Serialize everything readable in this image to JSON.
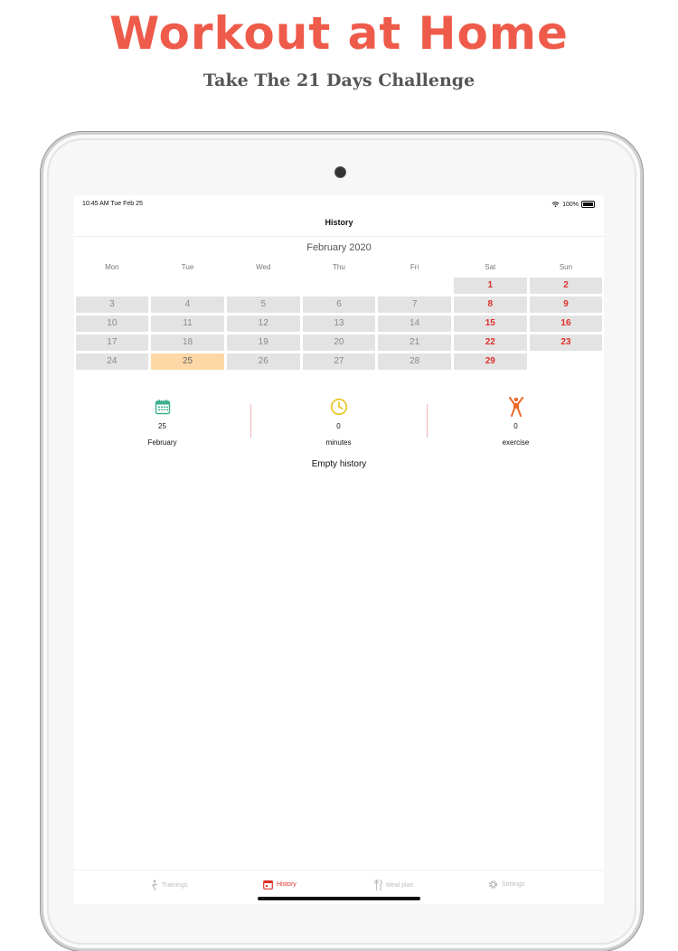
{
  "promo": {
    "title": "Workout at Home",
    "subtitle": "Take The 21 Days Challenge"
  },
  "status_bar": {
    "time_date": "10:45 AM  Tue Feb 25",
    "battery": "100%"
  },
  "nav": {
    "title": "History"
  },
  "calendar": {
    "month": "February 2020",
    "weekdays": [
      "Mon",
      "Tue",
      "Wed",
      "Thu",
      "Fri",
      "Sat",
      "Sun"
    ],
    "today": "25"
  },
  "stats": {
    "date": {
      "value": "25",
      "label": "February"
    },
    "minutes": {
      "value": "0",
      "label": "minutes"
    },
    "exercise": {
      "value": "0",
      "label": "exercise"
    }
  },
  "empty_text": "Empty history",
  "tabs": {
    "trainings": "Trainings",
    "history": "History",
    "meal_plan": "Meal plan",
    "settings": "Settings"
  },
  "colors": {
    "accent": "#e0302b",
    "promo": "#ee5b4a",
    "today_bg": "#fdd7a5",
    "calendar_icon": "#3bb08f",
    "clock_icon": "#e8c21b",
    "exercise_icon": "#ee6a2a"
  }
}
